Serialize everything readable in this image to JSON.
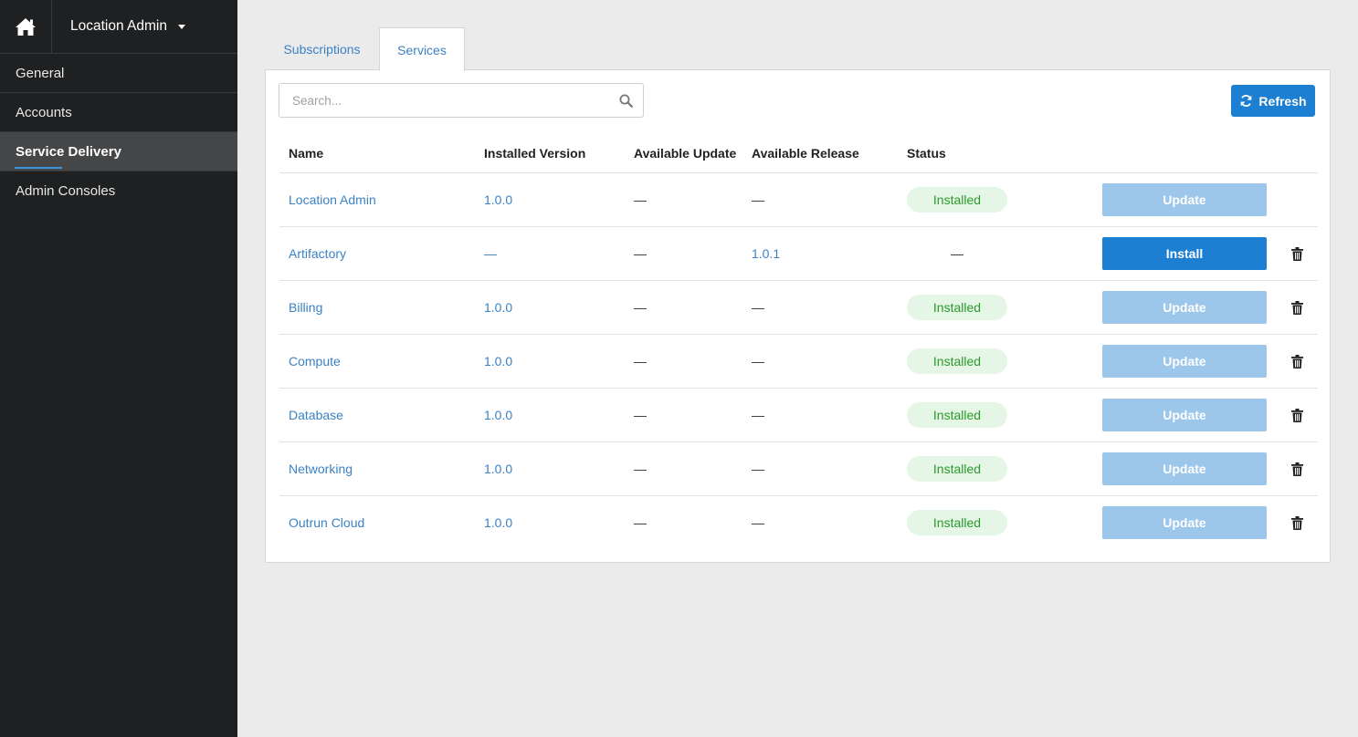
{
  "sidebar": {
    "app_switcher": {
      "label": "Location Admin"
    },
    "items": [
      {
        "label": "General",
        "active": false
      },
      {
        "label": "Accounts",
        "active": false
      },
      {
        "label": "Service Delivery",
        "active": true
      },
      {
        "label": "Admin Consoles",
        "active": false
      }
    ]
  },
  "tabs": [
    {
      "label": "Subscriptions",
      "active": false
    },
    {
      "label": "Services",
      "active": true
    }
  ],
  "search": {
    "placeholder": "Search...",
    "value": ""
  },
  "refresh_label": "Refresh",
  "table": {
    "headers": {
      "name": "Name",
      "installed_version": "Installed Version",
      "available_update": "Available Update",
      "available_release": "Available Release",
      "status": "Status"
    },
    "rows": [
      {
        "name": "Location Admin",
        "installed_version": "1.0.0",
        "available_update": "—",
        "available_release": "—",
        "status": "Installed",
        "action": "Update"
      },
      {
        "name": "Artifactory",
        "installed_version": "—",
        "available_update": "—",
        "available_release": "1.0.1",
        "status": "—",
        "action": "Install"
      },
      {
        "name": "Billing",
        "installed_version": "1.0.0",
        "available_update": "—",
        "available_release": "—",
        "status": "Installed",
        "action": "Update"
      },
      {
        "name": "Compute",
        "installed_version": "1.0.0",
        "available_update": "—",
        "available_release": "—",
        "status": "Installed",
        "action": "Update"
      },
      {
        "name": "Database",
        "installed_version": "1.0.0",
        "available_update": "—",
        "available_release": "—",
        "status": "Installed",
        "action": "Update"
      },
      {
        "name": "Networking",
        "installed_version": "1.0.0",
        "available_update": "—",
        "available_release": "—",
        "status": "Installed",
        "action": "Update"
      },
      {
        "name": "Outrun Cloud",
        "installed_version": "1.0.0",
        "available_update": "—",
        "available_release": "—",
        "status": "Installed",
        "action": "Update"
      }
    ]
  },
  "colors": {
    "sidebar_bg": "#1f2021",
    "accent": "#1d7fd1",
    "link": "#3b82c4",
    "disabled_button": "#9cc6ea",
    "installed_badge_bg": "#e6f6e6",
    "installed_badge_text": "#2a9a2a"
  },
  "icons": [
    "home-icon",
    "caret-down-icon",
    "search-icon",
    "refresh-icon",
    "trash-icon"
  ]
}
